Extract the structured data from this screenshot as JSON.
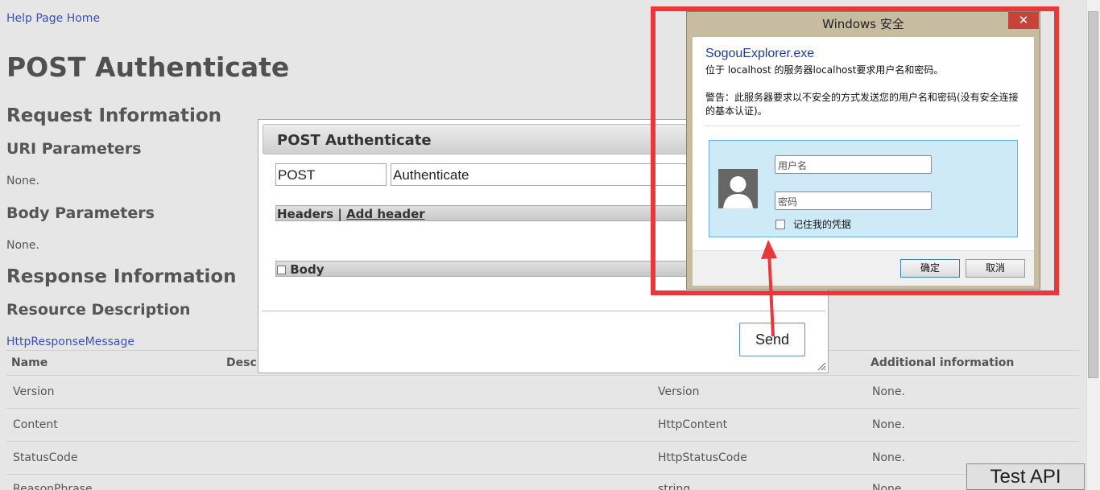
{
  "help": {
    "home_link": "Help Page Home",
    "title": "POST Authenticate",
    "request_info": "Request Information",
    "uri_params": "URI Parameters",
    "uri_none": "None.",
    "body_params": "Body Parameters",
    "body_none": "None.",
    "response_info": "Response Information",
    "resource_desc": "Resource Description",
    "resource_link": "HttpResponseMessage",
    "table": {
      "headers": [
        "Name",
        "Desc",
        "Additional information"
      ],
      "rows": [
        {
          "name": "Version",
          "type": "Version",
          "info": "None."
        },
        {
          "name": "Content",
          "type": "HttpContent",
          "info": "None."
        },
        {
          "name": "StatusCode",
          "type": "HttpStatusCode",
          "info": "None."
        },
        {
          "name": "ReasonPhrase",
          "type": "string",
          "info": "None."
        }
      ]
    }
  },
  "test_api_button": "Test API",
  "dialog": {
    "title": "POST Authenticate",
    "method_value": "POST",
    "uri_value": "Authenticate",
    "headers_label": "Headers",
    "separator": "|",
    "add_header": "Add header",
    "body_label": "Body",
    "send": "Send"
  },
  "security": {
    "title": "Windows 安全",
    "close": "✕",
    "app": "SogouExplorer.exe",
    "line1": "位于 localhost 的服务器localhost要求用户名和密码。",
    "warning1": "警告：此服务器要求以不安全的方式发送您的用户名和密码(没有安全连接",
    "warning2": "的基本认证)。",
    "username_placeholder": "用户名",
    "password_placeholder": "密码",
    "remember": "记住我的凭据",
    "ok": "确定",
    "cancel": "取消"
  },
  "colors": {
    "highlight_red": "#e8383b",
    "link_blue": "#3a52b4"
  }
}
